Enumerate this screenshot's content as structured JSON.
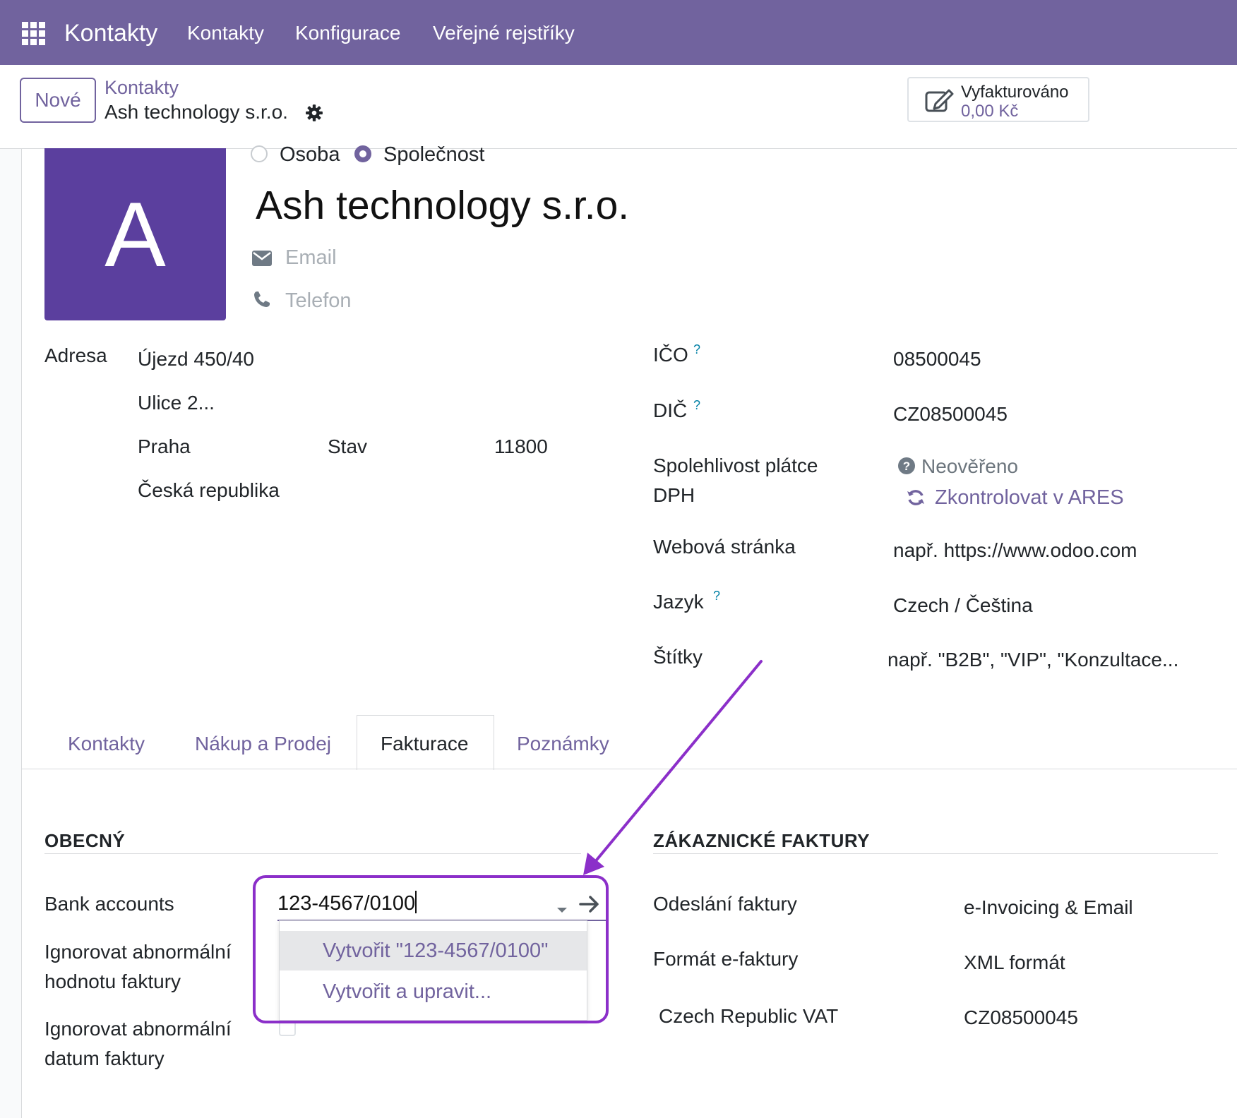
{
  "navbar": {
    "brand": "Kontakty",
    "menu": [
      "Kontakty",
      "Konfigurace",
      "Veřejné rejstříky"
    ]
  },
  "control": {
    "new_label": "Nové",
    "breadcrumb_parent": "Kontakty",
    "breadcrumb_current": "Ash technology s.r.o.",
    "stat_label": "Vyfakturováno",
    "stat_value": "0,00 Kč"
  },
  "form": {
    "avatar_letter": "A",
    "company_type": {
      "person": "Osoba",
      "company": "Společnost",
      "selected": "Společnost"
    },
    "name": "Ash technology s.r.o.",
    "email_placeholder": "Email",
    "phone_placeholder": "Telefon",
    "address": {
      "label": "Adresa",
      "street": "Újezd 450/40",
      "street2_placeholder": "Ulice 2...",
      "city": "Praha",
      "state_placeholder": "Stav",
      "zip": "11800",
      "country": "Česká republika"
    },
    "ico": {
      "label": "IČO",
      "help": "?",
      "value": "08500045"
    },
    "dic": {
      "label": "DIČ",
      "help": "?",
      "value": "CZ08500045"
    },
    "vat_reliability": {
      "label_line1": "Spolehlivost plátce",
      "label_line2": "DPH",
      "status": "Neověřeno",
      "action": "Zkontrolovat v ARES"
    },
    "website": {
      "label": "Webová stránka",
      "placeholder": "např. https://www.odoo.com"
    },
    "language": {
      "label": "Jazyk",
      "help": "?",
      "value": "Czech / Čeština"
    },
    "tags": {
      "label": "Štítky",
      "placeholder": "např. \"B2B\", \"VIP\", \"Konzultace..."
    }
  },
  "tabs": [
    {
      "label": "Kontakty",
      "active": false
    },
    {
      "label": "Nákup a Prodej",
      "active": false
    },
    {
      "label": "Fakturace",
      "active": true
    },
    {
      "label": "Poznámky",
      "active": false
    }
  ],
  "billing": {
    "general_title": "OBECNÝ",
    "bank_accounts_label": "Bank accounts",
    "bank_input_value": "123-4567/0100",
    "dropdown": [
      "Vytvořit \"123-4567/0100\"",
      "Vytvořit a upravit..."
    ],
    "ignore_amount_line1": "Ignorovat abnormální",
    "ignore_amount_line2": "hodnotu faktury",
    "ignore_date_line1": "Ignorovat abnormální",
    "ignore_date_line2": "datum faktury",
    "customer_title": "ZÁKAZNICKÉ FAKTURY",
    "invoice_sending_label": "Odeslání faktury",
    "invoice_sending_placeholder": "e-Invoicing & Email",
    "einvoice_format_label": "Formát e-faktury",
    "einvoice_format_placeholder": "XML formát",
    "vat_label": "Czech Republic VAT",
    "vat_value": "CZ08500045"
  },
  "colors": {
    "brand": "#71639e",
    "avatar": "#5b3f9e",
    "annotation": "#8b2fc9"
  }
}
